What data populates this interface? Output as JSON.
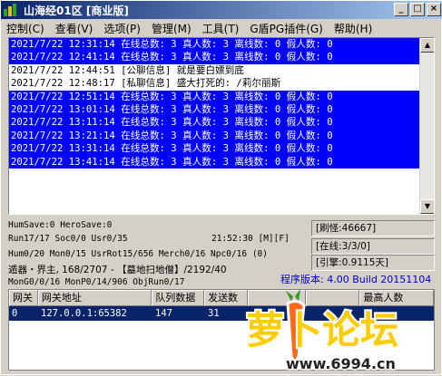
{
  "window": {
    "title": "山海经01区 [商业版]"
  },
  "title_buttons": {
    "minimize": "_",
    "maximize": "□",
    "close": "×"
  },
  "menu": [
    "控制(C)",
    "查看(V)",
    "选项(P)",
    "管理(M)",
    "工具(T)",
    "G盾PG插件(G)",
    "帮助(H)"
  ],
  "log": [
    {
      "text": "2021/7/22 12:31:14 在线总数: 3 真人数: 3 离线数: 0 假人数: 0",
      "selected": true
    },
    {
      "text": "2021/7/22 12:41:14 在线总数: 3 真人数: 3 离线数: 0 假人数: 0",
      "selected": true
    },
    {
      "text": "2021/7/22 12:44:51 [公聊信息] 就是要白嫖到底",
      "selected": false
    },
    {
      "text": "2021/7/22 12:48:17 [私聊信息] 盛大打死的: /莉尔丽斯",
      "selected": false
    },
    {
      "text": "2021/7/22 12:51:14 在线总数: 3 真人数: 3 离线数: 0 假人数: 0",
      "selected": true
    },
    {
      "text": "2021/7/22 13:01:14 在线总数: 3 真人数: 3 离线数: 0 假人数: 0",
      "selected": true
    },
    {
      "text": "2021/7/22 13:11:14 在线总数: 3 真人数: 3 离线数: 0 假人数: 0",
      "selected": true
    },
    {
      "text": "2021/7/22 13:21:14 在线总数: 3 真人数: 3 离线数: 0 假人数: 0",
      "selected": true
    },
    {
      "text": "2021/7/22 13:31:14 在线总数: 3 真人数: 3 离线数: 0 假人数: 0",
      "selected": true
    },
    {
      "text": "2021/7/22 13:41:14 在线总数: 3 真人数: 3 离线数: 0 假人数: 0",
      "selected": true
    }
  ],
  "status": {
    "line1": "HumSave:0 HeroSave:0",
    "line2": "Run17/17 Soc0/0 Usr0/35",
    "time": "21:52:30 [M][F]",
    "line3": "Hum0/20 Mon0/15 UsrRot15/656 Merch0/16 Npc0/16 (0)",
    "line4": "遁器・界主, 168/2707 - 【墓地扫地僧】/2192/40",
    "line5": "MonG0/0/16 MonP0/14/906 ObjRun0/17"
  },
  "right_panel": {
    "refresh": "[刷怪:46667]",
    "online": "[在线:3/3/0]",
    "engine": "[引擎:0.9115天]"
  },
  "version": "程序版本: 4.00 Build 20151104",
  "table": {
    "headers": [
      "网关",
      "网关地址",
      "队列数据",
      "发送数",
      "",
      "",
      "最高人数"
    ],
    "rows": [
      [
        "0",
        "127.0.0.1:65382",
        "147",
        "31"
      ]
    ]
  },
  "watermark": {
    "text": "萝卜论坛",
    "url": "www.6994.cn"
  },
  "colors": {
    "selection": "#0000ff",
    "title_start": "#0a246a",
    "version_text": "#0000cc"
  }
}
